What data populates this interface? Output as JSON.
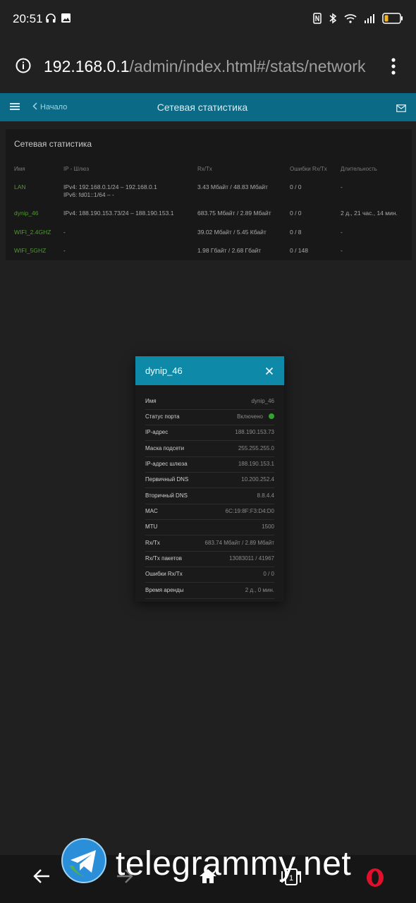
{
  "status_bar": {
    "time": "20:51"
  },
  "browser": {
    "url_host": "192.168.0.1",
    "url_path": "/admin/index.html#/stats/network"
  },
  "header": {
    "back_label": "Начало",
    "title": "Сетевая статистика"
  },
  "stats": {
    "title": "Сетевая статистика",
    "columns": [
      "Имя",
      "IP - Шлюз",
      "Rx/Tx",
      "Ошибки Rx/Tx",
      "Длительность"
    ],
    "rows": [
      {
        "name": "LAN",
        "ip_line1": "IPv4:  192.168.0.1/24 – 192.168.0.1",
        "ip_line2": "IPv6:  fd01::1/64 –  -",
        "rxtx": "3.43 Мбайт / 48.83 Мбайт",
        "errors": "0 / 0",
        "duration": "-"
      },
      {
        "name": "dynip_46",
        "ip_line1": "IPv4:  188.190.153.73/24 – 188.190.153.1",
        "ip_line2": "",
        "rxtx": "683.75 Мбайт / 2.89 Мбайт",
        "errors": "0 / 0",
        "duration": "2 д., 21 час., 14 мин."
      },
      {
        "name": "WIFI_2.4GHZ",
        "ip_line1": "-",
        "ip_line2": "",
        "rxtx": "39.02 Мбайт / 5.45 Кбайт",
        "errors": "0 / 8",
        "duration": "-"
      },
      {
        "name": "WIFI_5GHZ",
        "ip_line1": "-",
        "ip_line2": "",
        "rxtx": "1.98 Гбайт / 2.68 Гбайт",
        "errors": "0 / 148",
        "duration": "-"
      }
    ]
  },
  "dialog": {
    "title": "dynip_46",
    "rows": [
      {
        "label": "Имя",
        "value": "dynip_46"
      },
      {
        "label": "Статус порта",
        "value": "Включено"
      },
      {
        "label": "IP-адрес",
        "value": "188.190.153.73"
      },
      {
        "label": "Маска подсети",
        "value": "255.255.255.0"
      },
      {
        "label": "IP-адрес шлюза",
        "value": "188.190.153.1"
      },
      {
        "label": "Первичный DNS",
        "value": "10.200.252.4"
      },
      {
        "label": "Вторичный DNS",
        "value": "8.8.4.4"
      },
      {
        "label": "MAC",
        "value": "6C:19:8F:F3:D4:D0"
      },
      {
        "label": "MTU",
        "value": "1500"
      },
      {
        "label": "Rx/Tx",
        "value": "683.74 Мбайт / 2.89 Мбайт"
      },
      {
        "label": "Rx/Tx пакетов",
        "value": "13083011 / 41967"
      },
      {
        "label": "Ошибки Rx/Tx",
        "value": "0 / 0"
      },
      {
        "label": "Время аренды",
        "value": "2 д., 0 мин."
      }
    ]
  },
  "bottom_nav": {
    "tabs_count": "1"
  },
  "watermark": {
    "text": "telegrammy.net"
  },
  "colors": {
    "accent": "#0b6a86",
    "dialog_header": "#0e8aa8",
    "link_green": "#4e9a2e",
    "status_on": "#2fa52f"
  }
}
